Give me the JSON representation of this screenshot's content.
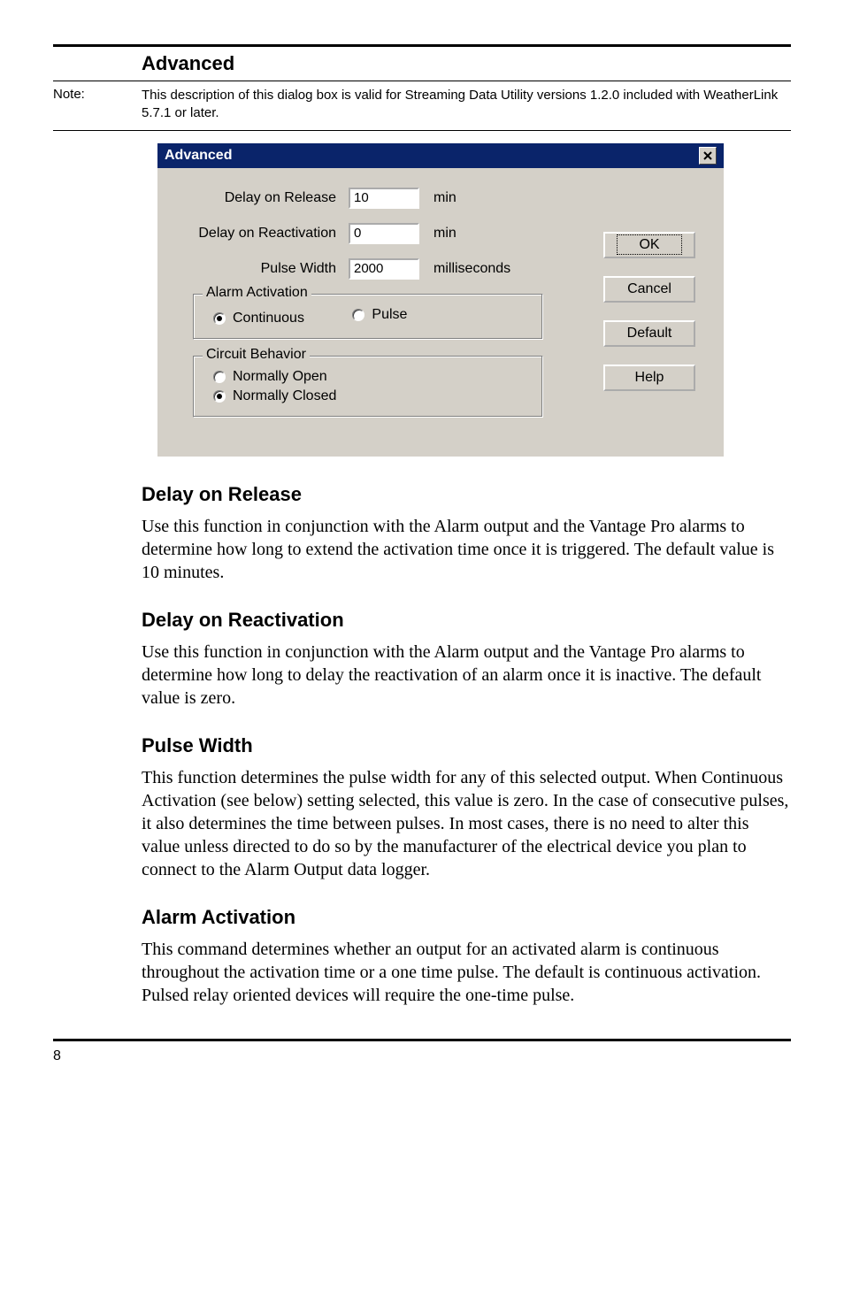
{
  "section_title": "Advanced",
  "note": {
    "label": "Note:",
    "text": "This description of this dialog box is valid for Streaming Data Utility versions 1.2.0 included with WeatherLink 5.7.1 or later."
  },
  "dialog": {
    "title": "Advanced",
    "delay_release": {
      "label": "Delay on Release",
      "value": "10",
      "unit": "min"
    },
    "delay_react": {
      "label": "Delay on Reactivation",
      "value": "0",
      "unit": "min"
    },
    "pulse_width": {
      "label": "Pulse Width",
      "value": "2000",
      "unit": "milliseconds"
    },
    "alarm_activation": {
      "legend": "Alarm Activation",
      "continuous": "Continuous",
      "pulse": "Pulse"
    },
    "circuit_behavior": {
      "legend": "Circuit Behavior",
      "open": "Normally Open",
      "closed": "Normally Closed"
    },
    "buttons": {
      "ok": "OK",
      "cancel": "Cancel",
      "default": "Default",
      "help": "Help"
    }
  },
  "sections": {
    "delay_release": {
      "h": "Delay on Release",
      "p": "Use this function in conjunction with the Alarm output and the Vantage Pro alarms to determine how long to extend the activation time once it is triggered. The default value is 10 minutes."
    },
    "delay_react": {
      "h": "Delay on Reactivation",
      "p": "Use this function in conjunction with the Alarm output and the Vantage Pro alarms to determine how long to delay the reactivation of an alarm once it is inactive. The default value is zero."
    },
    "pulse_width": {
      "h": "Pulse Width",
      "p": "This function determines the pulse width for any of this selected output. When Continuous Activation (see below) setting selected, this value is zero. In the case of consecutive pulses, it also determines the time between pulses. In most cases, there is no need to alter this value unless directed to do so by the manufacturer of the electrical device you plan to connect to the Alarm Output data logger."
    },
    "alarm_activation": {
      "h": "Alarm Activation",
      "p": "This command determines whether an output for an activated alarm is continuous throughout the activation time or a one time pulse. The default is continuous activation. Pulsed relay oriented devices will require the one-time pulse."
    }
  },
  "page_number": "8"
}
